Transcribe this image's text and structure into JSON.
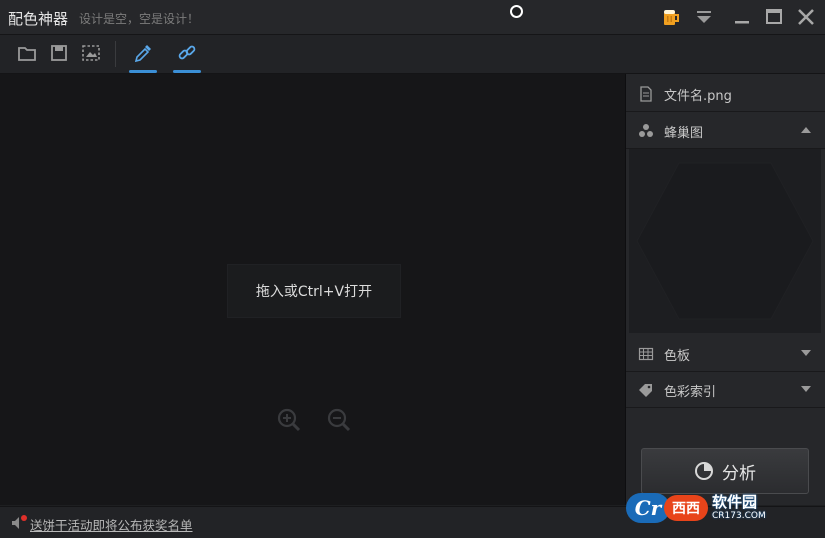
{
  "window": {
    "title": "配色神器",
    "slogan": "设计是空，空是设计！"
  },
  "titlebar_icons": [
    "beer-icon",
    "dropdown-menu-icon",
    "minimize-icon",
    "maximize-icon",
    "close-icon"
  ],
  "toolbar": {
    "tools": [
      "open-folder-icon",
      "save-icon",
      "screenshot-icon",
      "eyedropper-icon",
      "link-icon"
    ],
    "accent": "#3b8fd6"
  },
  "canvas": {
    "hint": "拖入或Ctrl+V打开",
    "zoom_in_icon": "zoom-in-icon",
    "zoom_out_icon": "zoom-out-icon"
  },
  "panel": {
    "filename": "文件名.png",
    "honeycomb": "蜂巢图",
    "palette": "色板",
    "color_index": "色彩索引",
    "analyze": "分析"
  },
  "status": {
    "link": "送饼干活动即将公布获奖名单"
  },
  "watermark": {
    "logo": "Cr",
    "mid": "西西",
    "name": "软件园",
    "domain": "CR173.COM"
  }
}
